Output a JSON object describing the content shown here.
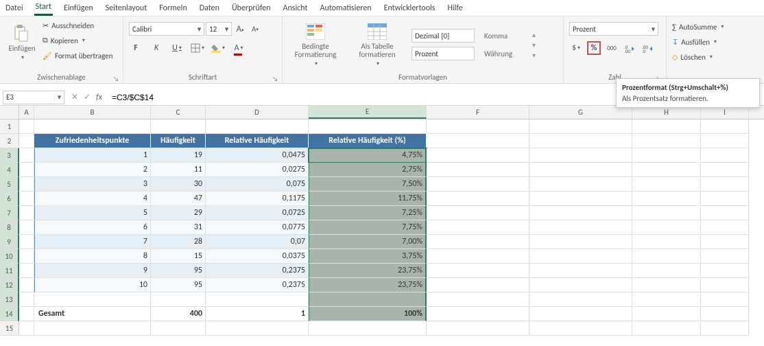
{
  "menu": {
    "tabs": [
      "Datei",
      "Start",
      "Einfügen",
      "Seitenlayout",
      "Formeln",
      "Daten",
      "Überprüfen",
      "Ansicht",
      "Automatisieren",
      "Entwicklertools",
      "Hilfe"
    ],
    "active": "Start"
  },
  "ribbon": {
    "clipboard": {
      "paste": "Einfügen",
      "cut": "Ausschneiden",
      "copy": "Kopieren",
      "painter": "Format übertragen",
      "caption": "Zwischenablage"
    },
    "font": {
      "name": "Calibri",
      "size": "12",
      "caption": "Schriftart"
    },
    "styles": {
      "cond": "Bedingte Formatierung",
      "table": "Als Tabelle formatieren",
      "style1_label": "Dezimal [0]",
      "style2_label": "Komma",
      "style3_value": "Prozent",
      "style4_label": "Währung",
      "caption": "Formatvorlagen"
    },
    "number": {
      "format": "Prozent",
      "caption": "Zahl"
    },
    "editing": {
      "sum": "AutoSumme",
      "fill": "Ausfüllen",
      "clear": "Löschen"
    }
  },
  "tooltip": {
    "title": "Prozentformat (Strg+Umschalt+%)",
    "body": "Als Prozentsatz formatieren."
  },
  "formula": {
    "name": "E3",
    "value": "=C3/$C$14"
  },
  "columns": [
    "A",
    "B",
    "C",
    "D",
    "E",
    "F",
    "G",
    "H",
    "I"
  ],
  "col_widths": {
    "A": 22,
    "B": 170,
    "C": 80,
    "D": 150,
    "E": 172,
    "F": 150,
    "G": 150,
    "H": 100,
    "I": 70
  },
  "sel_col": "E",
  "headers": {
    "b": "Zufriedenheitspunkte",
    "c": "Häufigkeit",
    "d": "Relative Häufigkeit",
    "e": "Relative Häufigkeit (%)"
  },
  "chart_data": {
    "type": "table",
    "columns": [
      "Zufriedenheitspunkte",
      "Häufigkeit",
      "Relative Häufigkeit",
      "Relative Häufigkeit (%)"
    ],
    "rows": [
      {
        "p": "1",
        "h": "19",
        "r": "0,0475",
        "pct": "4,75%"
      },
      {
        "p": "2",
        "h": "11",
        "r": "0,0275",
        "pct": "2,75%"
      },
      {
        "p": "3",
        "h": "30",
        "r": "0,075",
        "pct": "7,50%"
      },
      {
        "p": "4",
        "h": "47",
        "r": "0,1175",
        "pct": "11,75%"
      },
      {
        "p": "5",
        "h": "29",
        "r": "0,0725",
        "pct": "7,25%"
      },
      {
        "p": "6",
        "h": "31",
        "r": "0,0775",
        "pct": "7,75%"
      },
      {
        "p": "7",
        "h": "28",
        "r": "0,07",
        "pct": "7,00%"
      },
      {
        "p": "8",
        "h": "15",
        "r": "0,0375",
        "pct": "3,75%"
      },
      {
        "p": "9",
        "h": "95",
        "r": "0,2375",
        "pct": "23,75%"
      },
      {
        "p": "10",
        "h": "95",
        "r": "0,2375",
        "pct": "23,75%"
      }
    ],
    "total": {
      "label": "Gesamt",
      "h": "400",
      "r": "1",
      "pct": "100%"
    }
  }
}
